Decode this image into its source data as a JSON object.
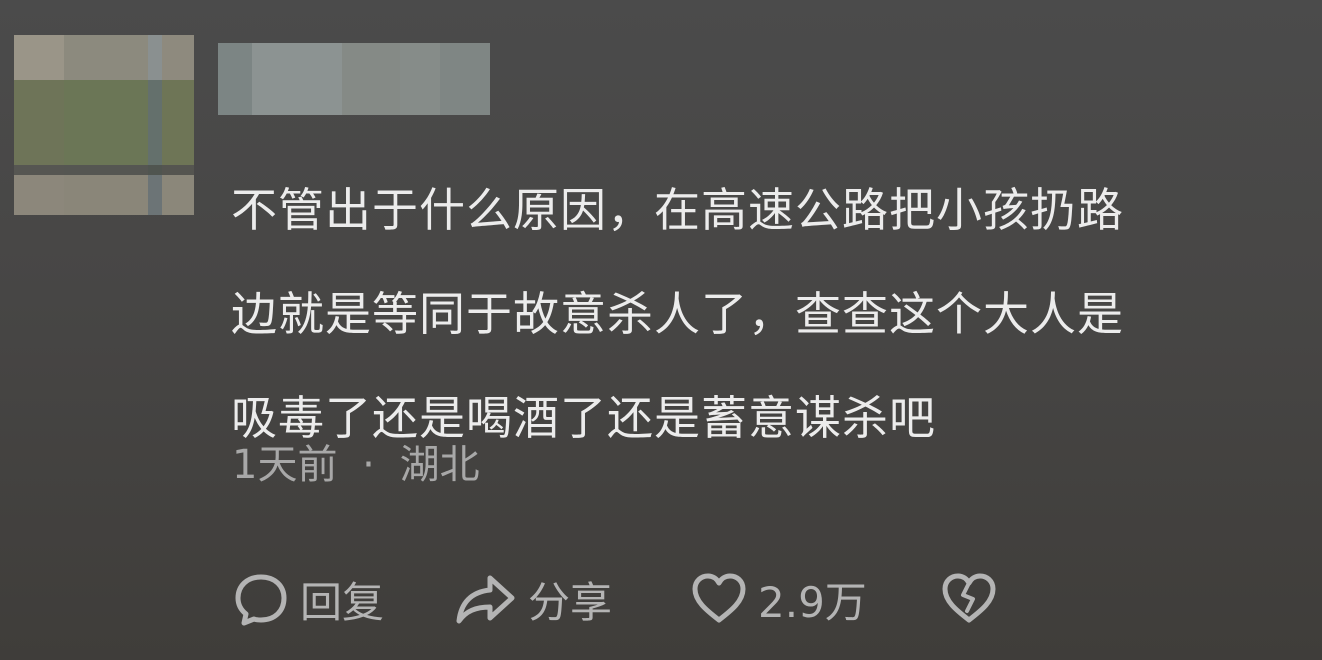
{
  "comment": {
    "text_lines": [
      "不管出于什么原因，在高速公路把小孩扔路",
      "边就是等同于故意杀人了，查查这个大人是",
      "吸毒了还是喝酒了还是蓄意谋杀吧"
    ],
    "time": "1天前",
    "separator": "·",
    "location": "湖北"
  },
  "actions": {
    "reply_label": "回复",
    "share_label": "分享",
    "like_count": "2.9万",
    "reply_icon": "speech-bubble-icon",
    "share_icon": "share-arrow-icon",
    "like_icon": "heart-icon",
    "dislike_icon": "broken-heart-icon"
  },
  "colors": {
    "background": "#474645",
    "text": "#ececec",
    "meta_text": "#a8a8a8",
    "icon": "#b4b4b4"
  },
  "avatar_mosaic": [
    [
      "#9a9588",
      "#8c8a7e",
      "#8a9090",
      "#8e8a7e"
    ],
    [
      "#6e7458",
      "#6b7656",
      "#64706c",
      "#6e7556"
    ],
    [
      "#565652",
      "#555652",
      "#505550",
      "#555550"
    ],
    [
      "#8c877b",
      "#8a8679",
      "#6c7476",
      "#8b877a"
    ]
  ],
  "username_mosaic": [
    "#7c8584",
    "#8c9392",
    "#858a86",
    "#868c89",
    "#7f8684"
  ]
}
